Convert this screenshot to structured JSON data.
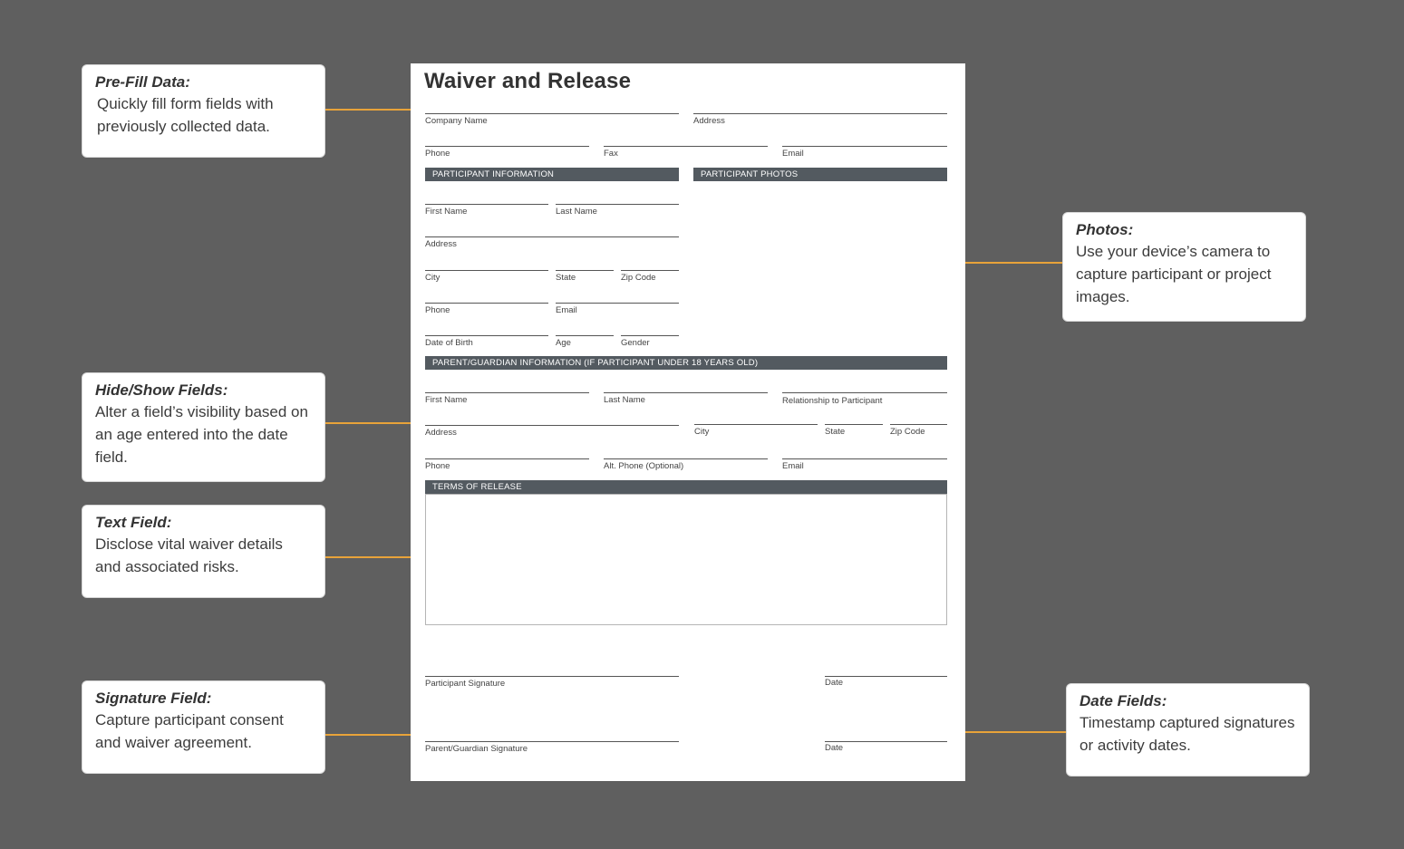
{
  "callouts": {
    "prefill": {
      "title": "Pre-Fill Data:",
      "text": "Quickly fill form fields with previously collected data."
    },
    "hideshow": {
      "title": "Hide/Show Fields:",
      "text": "Alter a field’s visibility based on an age entered into the date field."
    },
    "textfield": {
      "title": "Text Field:",
      "text": "Disclose vital waiver details and associated risks."
    },
    "signature": {
      "title": "Signature Field:",
      "text": "Capture participant consent and waiver agreement."
    },
    "photos": {
      "title": "Photos:",
      "text": "Use your device’s camera to capture participant or project images."
    },
    "datefields": {
      "title": "Date Fields:",
      "text": "Timestamp captured signatures or activity dates."
    }
  },
  "accent_color": "#e8a33a",
  "form": {
    "title": "Waiver and Release",
    "company": {
      "company_name": "Company Name",
      "address": "Address",
      "phone": "Phone",
      "fax": "Fax",
      "email": "Email"
    },
    "sections": {
      "participant_info": "PARTICIPANT INFORMATION",
      "participant_photos": "PARTICIPANT PHOTOS",
      "guardian_info": "PARENT/GUARDIAN INFORMATION (IF PARTICIPANT UNDER 18 YEARS OLD)",
      "terms": "TERMS OF RELEASE"
    },
    "participant": {
      "first_name": "First Name",
      "last_name": "Last Name",
      "address": "Address",
      "city": "City",
      "state": "State",
      "zip": "Zip Code",
      "phone": "Phone",
      "email": "Email",
      "dob": "Date of Birth",
      "age": "Age",
      "gender": "Gender"
    },
    "guardian": {
      "first_name": "First Name",
      "last_name": "Last Name",
      "relationship": "Relationship to Participant",
      "address": "Address",
      "city": "City",
      "state": "State",
      "zip": "Zip Code",
      "phone": "Phone",
      "alt_phone": "Alt. Phone (Optional)",
      "email": "Email"
    },
    "signatures": {
      "participant_signature": "Participant Signature",
      "date1": "Date",
      "guardian_signature": "Parent/Guardian Signature",
      "date2": "Date"
    }
  }
}
